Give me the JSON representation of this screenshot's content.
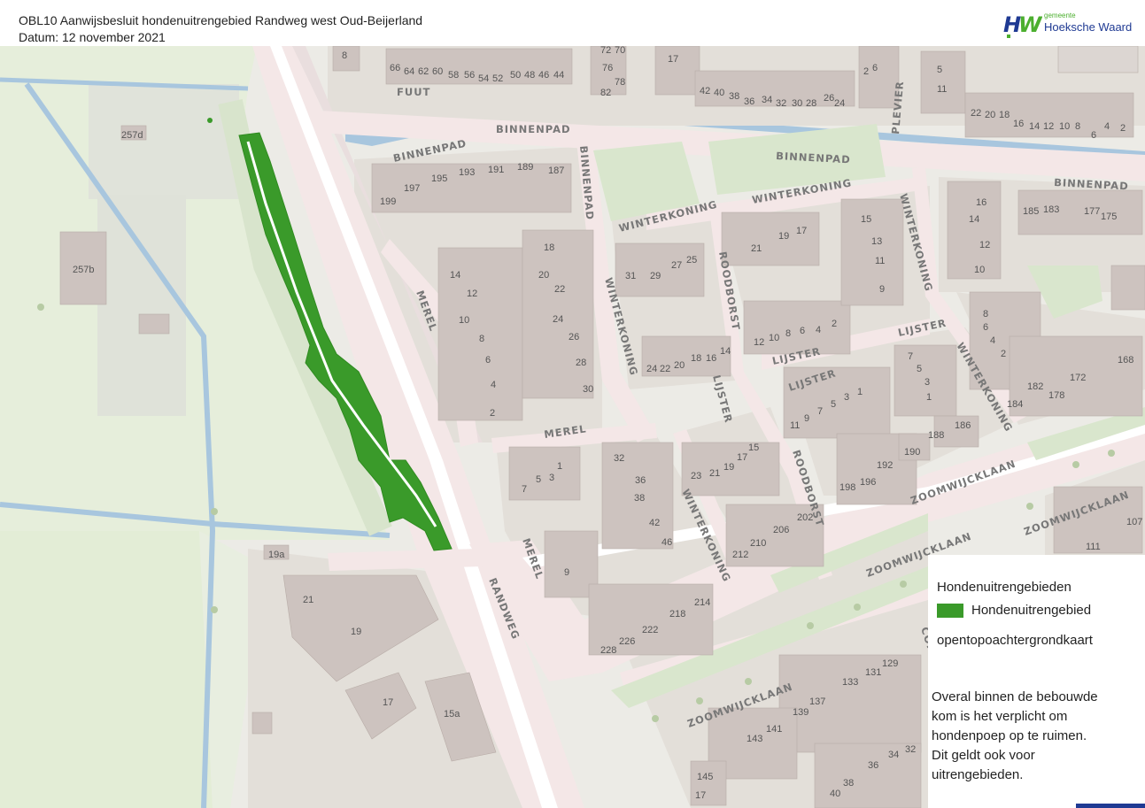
{
  "header": {
    "title": "OBL10 Aanwijsbesluit hondenuitrengebied Randweg west Oud-Beijerland",
    "date": "Datum: 12 november 2021"
  },
  "logo": {
    "mark": "HW",
    "small": "gemeente",
    "name": "Hoeksche Waard",
    "colors": {
      "green": "#4caf2f",
      "blue": "#1f3a93"
    }
  },
  "legend": {
    "title": "Hondenuitrengebieden",
    "item": "Hondenuitrengebied",
    "item_color": "#3a9a2a",
    "background": "opentopoachtergrondkaart",
    "note_lines": [
      "Overal binnen de bebouwde",
      "kom is het verplicht om",
      "hondenpoep op te ruimen.",
      "Dit geldt ook voor",
      "uitrengebieden."
    ]
  },
  "map": {
    "streets": {
      "fuut": "FUUT",
      "binnenpad": "BINNENPAD",
      "winterkoning": "WINTERKONING",
      "merel": "MEREL",
      "roodborst": "ROODBORST",
      "lijster": "LIJSTER",
      "zoomwijcklaan": "ZOOMWIJCKLAAN",
      "randweg": "RANDWEG",
      "plevier": "PLEVIER",
      "cornelis": "CORNELIS D"
    },
    "numbers": {
      "n257d": "257d",
      "n257b": "257b",
      "n19a": "19a",
      "n21": "21",
      "n19": "19",
      "n17": "17",
      "n15a": "15a",
      "n8": "8",
      "n66": "66",
      "n64": "64",
      "n62": "62",
      "n60": "60",
      "n58": "58",
      "n56": "56",
      "n54": "54",
      "n52": "52",
      "n50": "50",
      "n48": "48",
      "n46": "46",
      "n44": "44",
      "n72": "72",
      "n70": "70",
      "n76": "76",
      "n78": "78",
      "n82": "82",
      "n42": "42",
      "n40": "40",
      "n38": "38",
      "n36": "36",
      "n34": "34",
      "n32": "32",
      "n30": "30",
      "n28": "28",
      "n26": "26",
      "n24": "24",
      "n2": "2",
      "n6": "6",
      "n5": "5",
      "n11": "11",
      "n22": "22",
      "n20": "20",
      "n18": "18",
      "n16": "16",
      "n14": "14",
      "n12": "12",
      "n10": "10",
      "n4": "4",
      "n199": "199",
      "n197": "197",
      "n195": "195",
      "n193": "193",
      "n191": "191",
      "n189": "189",
      "n187": "187",
      "n185": "185",
      "n183": "183",
      "n177": "177",
      "n175": "175",
      "n31": "31",
      "n29": "29",
      "n27": "27",
      "n25": "25",
      "n15": "15",
      "n13": "13",
      "n9": "9",
      "n3": "3",
      "n1": "1",
      "n7": "7",
      "n168": "168",
      "n172": "172",
      "n178": "178",
      "n182": "182",
      "n184": "184",
      "n186": "186",
      "n188": "188",
      "n190": "190",
      "n192": "192",
      "n196": "196",
      "n198": "198",
      "n202": "202",
      "n206": "206",
      "n210": "210",
      "n212": "212",
      "n214": "214",
      "n218": "218",
      "n222": "222",
      "n226": "226",
      "n228": "228",
      "n107": "107",
      "n111": "111",
      "n129": "129",
      "n131": "131",
      "n133": "133",
      "n137": "137",
      "n139": "139",
      "n141": "141",
      "n143": "143",
      "n145": "145",
      "n23": "23",
      "n21b": "21",
      "n19b": "19",
      "n17b": "17",
      "n15b": "15"
    }
  }
}
